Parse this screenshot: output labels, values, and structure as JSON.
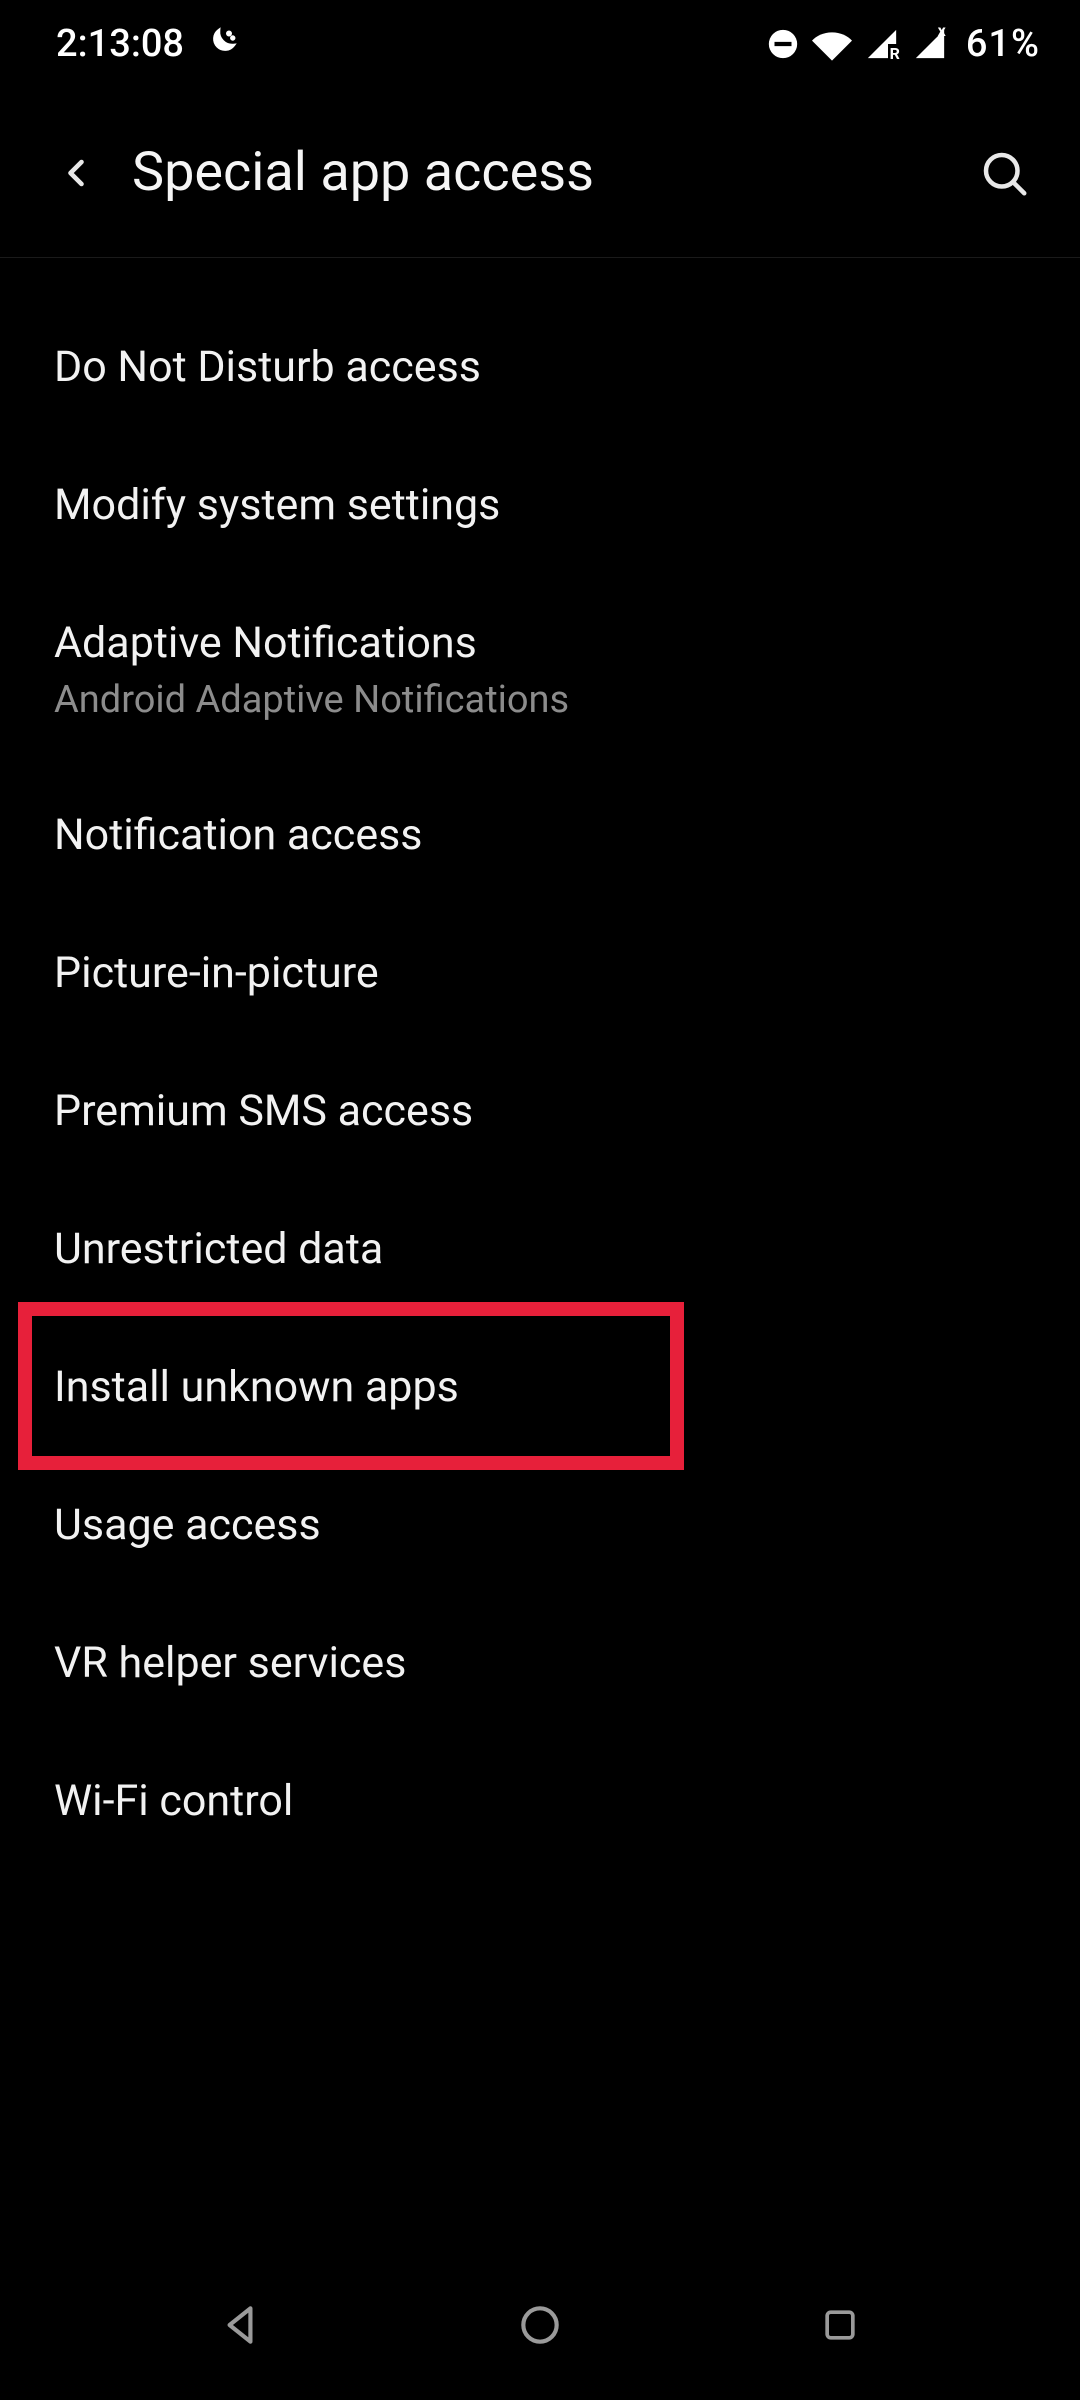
{
  "status": {
    "time": "2:13:08",
    "battery": "61%"
  },
  "header": {
    "title": "Special app access"
  },
  "items": [
    {
      "title": "Do Not Disturb access",
      "sub": ""
    },
    {
      "title": "Modify system settings",
      "sub": ""
    },
    {
      "title": "Adaptive Notifications",
      "sub": "Android Adaptive Notifications"
    },
    {
      "title": "Notification access",
      "sub": ""
    },
    {
      "title": "Picture-in-picture",
      "sub": ""
    },
    {
      "title": "Premium SMS access",
      "sub": ""
    },
    {
      "title": "Unrestricted data",
      "sub": ""
    },
    {
      "title": "Install unknown apps",
      "sub": ""
    },
    {
      "title": "Usage access",
      "sub": ""
    },
    {
      "title": "VR helper services",
      "sub": ""
    },
    {
      "title": "Wi-Fi control",
      "sub": ""
    }
  ],
  "highlighted_index": 7
}
